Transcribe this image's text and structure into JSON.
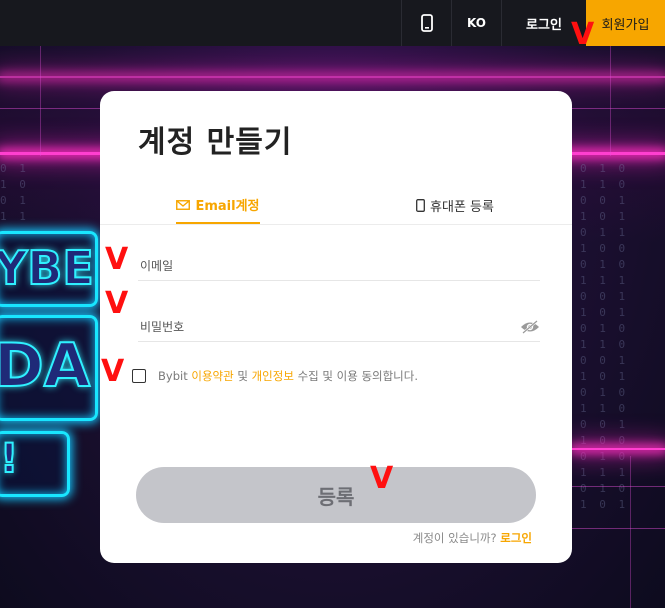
{
  "nav": {
    "lang_label": "KO",
    "login_label": "로그인",
    "signup_label": "회원가입",
    "phone_icon": "mobile-phone-icon"
  },
  "card": {
    "title": "계정 만들기",
    "tabs": [
      {
        "label": "Email계정",
        "icon": "envelope-icon",
        "active": true
      },
      {
        "label": "휴대폰 등록",
        "icon": "mobile-phone-icon",
        "active": false
      }
    ],
    "email_placeholder": "이메일",
    "email_value": "",
    "password_placeholder": "비밀번호",
    "password_value": "",
    "agree": {
      "prefix": "Bybit",
      "terms_link": "이용약관",
      "and": "및",
      "privacy_link": "개인정보",
      "suffix": "수집 및 이용 동의합니다.",
      "checked": false
    },
    "submit_label": "등록",
    "footer": {
      "question": "계정이 있습니까?",
      "login_link": "로그인"
    }
  },
  "annotations": [
    "V",
    "V",
    "V",
    "V",
    "V"
  ],
  "colors": {
    "accent": "#f7a600",
    "topbar": "#17181e",
    "button_disabled": "#c4c5ca",
    "annotation": "#ff1010"
  }
}
